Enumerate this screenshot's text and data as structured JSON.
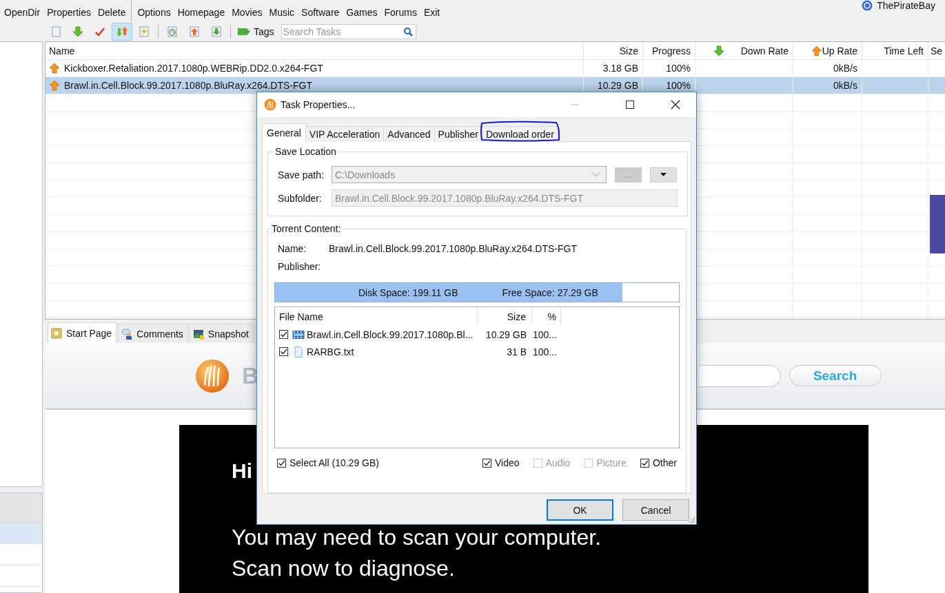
{
  "toolbar": {
    "items": [
      {
        "label": "OpenDir"
      },
      {
        "label": "Properties"
      },
      {
        "label": "Delete",
        "separator_after": true
      },
      {
        "label": "Options"
      },
      {
        "label": "Homepage"
      },
      {
        "label": "Movies"
      },
      {
        "label": "Music"
      },
      {
        "label": "Software"
      },
      {
        "label": "Games"
      },
      {
        "label": "Forums"
      },
      {
        "label": "Exit"
      }
    ],
    "account": "ThePirateBay"
  },
  "task_toolbar": {
    "tools": [
      {
        "pressed": false
      },
      {
        "pressed": false
      },
      {
        "pressed": false
      },
      {
        "pressed": true
      },
      {
        "pressed": false
      },
      {
        "pressed": false
      },
      {
        "pressed": false
      },
      {
        "pressed": false
      }
    ],
    "tags": "Tags",
    "search": {
      "placeholder": "Search Tasks"
    }
  },
  "sidebar": {
    "rows": [
      {
        "selected": true
      },
      {
        "selected": false
      },
      {
        "selected": false
      }
    ]
  },
  "task_list": {
    "columns": [
      "Name",
      "Size",
      "Progress",
      "Down Rate",
      "Up Rate",
      "Time Left",
      "Se"
    ],
    "rows": [
      {
        "name": "Kickboxer.Retaliation.2017.1080p.WEBRip.DD2.0.x264-FGT",
        "size": "3.18 GB",
        "progress": "100%",
        "up_rate": "0kB/s",
        "selected": false
      },
      {
        "name": "Brawl.in.Cell.Block.99.2017.1080p.BluRay.x264.DTS-FGT",
        "size": "10.29 GB",
        "progress": "100%",
        "up_rate": "0kB/s",
        "selected": true
      }
    ]
  },
  "bottom_tabs": [
    {
      "label": "Start Page",
      "selected": true
    },
    {
      "label": "Comments",
      "selected": false
    },
    {
      "label": "Snapshot",
      "selected": false
    }
  ],
  "browser": {
    "logo_text": "B",
    "search_button": "Search",
    "ad_lines": [
      "Hi",
      "You may need to scan your computer.",
      "Scan now to diagnose."
    ]
  },
  "dialog": {
    "title": "Task Properties...",
    "tabs": [
      {
        "label": "General",
        "selected": true,
        "highlighted": false
      },
      {
        "label": "VIP Acceleration",
        "selected": false,
        "highlighted": false
      },
      {
        "label": "Advanced",
        "selected": false,
        "highlighted": false
      },
      {
        "label": "Publisher",
        "selected": false,
        "highlighted": false
      },
      {
        "label": "Download order",
        "selected": false,
        "highlighted": true
      }
    ],
    "save_location": {
      "legend": "Save Location",
      "save_path_label": "Save path:",
      "save_path": "C:\\Downloads",
      "browse_button": "...",
      "subfolder_label": "Subfolder:",
      "subfolder": "Brawl.in.Cell.Block.99.2017.1080p.BluRay.x264.DTS-FGT"
    },
    "torrent_content": {
      "legend": "Torrent Content:",
      "name_label": "Name:",
      "name": "Brawl.in.Cell.Block.99.2017.1080p.BluRay.x264.DTS-FGT",
      "publisher_label": "Publisher:",
      "disk": {
        "level": 0.86,
        "disk_space": "Disk Space: 199.11 GB",
        "free_space": "Free Space: 27.29 GB"
      },
      "columns": [
        "File Name",
        "Size",
        "%"
      ],
      "files": [
        {
          "kind": "video",
          "name": "Brawl.in.Cell.Block.99.2017.1080p.Bl...",
          "size": "10.29 GB",
          "percent": "100...",
          "checked": true
        },
        {
          "kind": "text",
          "name": "RARBG.txt",
          "size": "31 B",
          "percent": "100...",
          "checked": true
        }
      ],
      "select_all": {
        "label": "Select All (10.29 GB)",
        "checked": true
      },
      "filters": [
        {
          "label": "Video",
          "checked": true,
          "disabled": false
        },
        {
          "label": "Audio",
          "checked": false,
          "disabled": true
        },
        {
          "label": "Picture",
          "checked": false,
          "disabled": true
        },
        {
          "label": "Other",
          "checked": true,
          "disabled": false
        }
      ]
    },
    "buttons": [
      {
        "label": "OK",
        "default": true
      },
      {
        "label": "Cancel",
        "default": false
      }
    ]
  }
}
